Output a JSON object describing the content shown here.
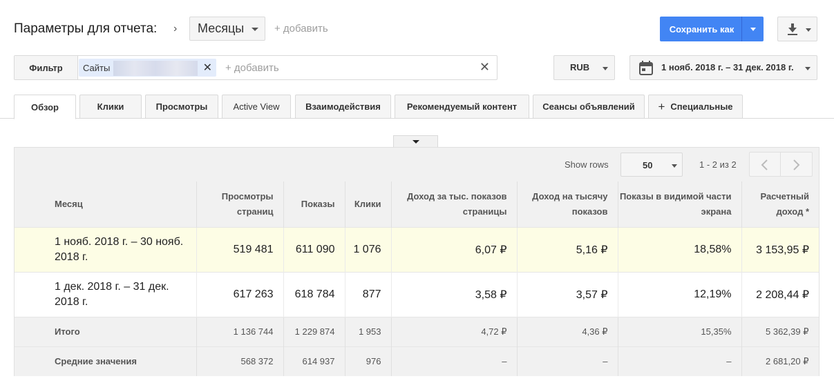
{
  "header": {
    "title": "Параметры для отчета:",
    "dimension": "Месяцы",
    "add_dimension": "+ добавить",
    "save_label": "Сохранить как"
  },
  "filter": {
    "label": "Фильтр",
    "chip_label": "Сайты",
    "add_placeholder": "+ добавить"
  },
  "currency": "RUB",
  "date_range": "1 нояб. 2018 г. – 31 дек. 2018 г.",
  "tabs": [
    {
      "label": "Обзор",
      "active": true
    },
    {
      "label": "Клики"
    },
    {
      "label": "Просмотры"
    },
    {
      "label": "Active View"
    },
    {
      "label": "Взаимодействия"
    },
    {
      "label": "Рекомендуемый контент"
    },
    {
      "label": "Сеансы объявлений"
    },
    {
      "label": "Специальные"
    }
  ],
  "table_controls": {
    "show_rows_label": "Show rows",
    "rows_value": "50",
    "range_text": "1 - 2 из 2"
  },
  "columns": [
    "Месяц",
    "Просмотры страниц",
    "Показы",
    "Клики",
    "Доход за тыс. показов страницы",
    "Доход на тысячу показов",
    "Показы в видимой части экрана",
    "Расчетный доход *"
  ],
  "rows": [
    [
      "1 нояб. 2018 г. – 30 нояб. 2018 г.",
      "519 481",
      "611 090",
      "1 076",
      "6,07 ₽",
      "5,16 ₽",
      "18,58%",
      "3 153,95 ₽"
    ],
    [
      "1 дек. 2018 г. – 31 дек. 2018 г.",
      "617 263",
      "618 784",
      "877",
      "3,58 ₽",
      "3,57 ₽",
      "12,19%",
      "2 208,44 ₽"
    ]
  ],
  "totals": [
    "Итого",
    "1 136 744",
    "1 229 874",
    "1 953",
    "4,72 ₽",
    "4,36 ₽",
    "15,35%",
    "5 362,39 ₽"
  ],
  "averages": [
    "Средние значения",
    "568 372",
    "614 937",
    "976",
    "–",
    "–",
    "–",
    "2 681,20 ₽"
  ]
}
